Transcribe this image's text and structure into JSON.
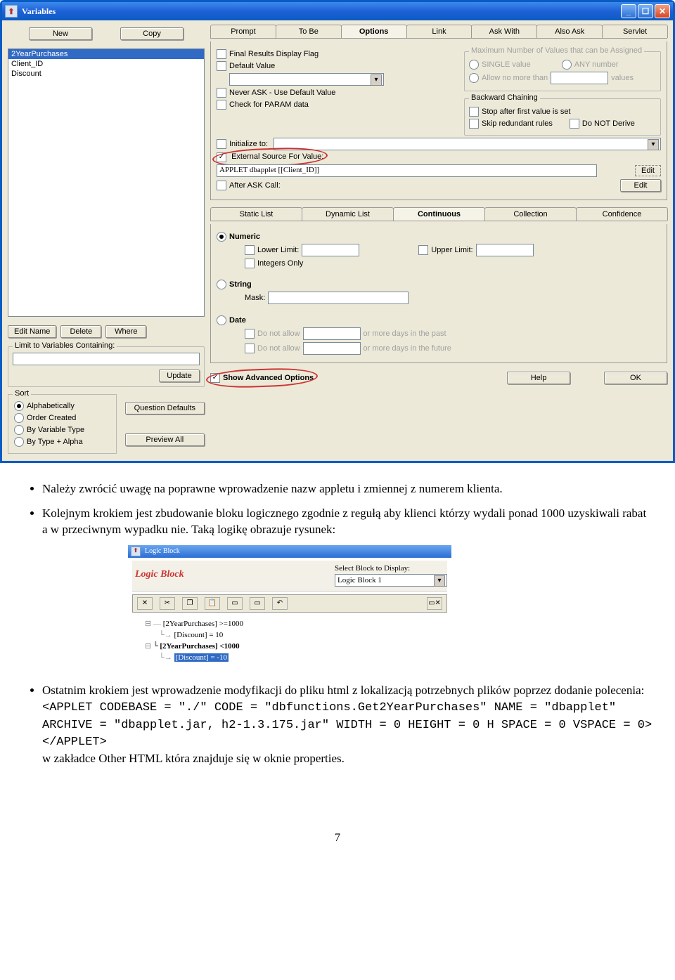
{
  "window": {
    "title": "Variables",
    "buttons": {
      "new": "New",
      "copy": "Copy"
    },
    "list": [
      "2YearPurchases",
      "Client_ID",
      "Discount"
    ],
    "leftButtons": {
      "editName": "Edit Name",
      "delete": "Delete",
      "where": "Where",
      "update": "Update"
    },
    "limitLabel": "Limit to Variables Containing:",
    "sort": {
      "legend": "Sort",
      "alpha": "Alphabetically",
      "order": "Order Created",
      "byVar": "By Variable Type",
      "byType": "By Type + Alpha"
    },
    "sideButtons": {
      "qdef": "Question Defaults",
      "preview": "Preview All"
    },
    "tabs1": [
      "Prompt",
      "To Be",
      "Options",
      "Link",
      "Ask With",
      "Also Ask",
      "Servlet"
    ],
    "options": {
      "finalResults": "Final Results Display Flag",
      "defaultValue": "Default Value",
      "neverAsk": "Never ASK - Use Default Value",
      "checkParam": "Check for PARAM data",
      "initTo": "Initialize to:",
      "extSource": "External Source For Value:",
      "extValue": "APPLET dbapplet [[Client_ID]]",
      "afterAsk": "After ASK Call:",
      "edit": "Edit",
      "maxGroup": "Maximum Number of Values that can be Assigned",
      "single": "SINGLE value",
      "any": "ANY number",
      "allowNoMore": "Allow no more than",
      "valuesWord": "values",
      "backward": "Backward Chaining",
      "stopFirst": "Stop after first value is set",
      "skipRed": "Skip redundant rules",
      "doNotDerive": "Do NOT Derive"
    },
    "tabs2": [
      "Static List",
      "Dynamic List",
      "Continuous",
      "Collection",
      "Confidence"
    ],
    "cont": {
      "numeric": "Numeric",
      "lower": "Lower Limit:",
      "upper": "Upper Limit:",
      "ints": "Integers Only",
      "string": "String",
      "mask": "Mask:",
      "date": "Date",
      "dna1": "Do not allow",
      "past": "or more days in the past",
      "future": "or more days in the future"
    },
    "showAdv": "Show Advanced Options",
    "help": "Help",
    "ok": "OK"
  },
  "doc": {
    "b1": "Należy zwrócić uwagę na poprawne wprowadzenie nazw appletu i zmiennej z numerem klienta.",
    "b2": "Kolejnym krokiem jest zbudowanie bloku logicznego zgodnie z regułą aby klienci którzy wydali ponad 1000 uzyskiwali rabat a w przeciwnym wypadku nie. Taką logikę obrazuje rysunek:",
    "b3a": "Ostatnim krokiem jest wprowadzenie modyfikacji do pliku html z lokalizacją potrzebnych plików poprzez dodanie polecenia:",
    "code": "<APPLET CODEBASE = \"./\" CODE = \"dbfunctions.Get2YearPurchases\" NAME = \"dbapplet\" ARCHIVE = \"dbapplet.jar, h2-1.3.175.jar\" WIDTH = 0 HEIGHT = 0 H SPACE = 0 VSPACE = 0></APPLET>",
    "b3b": "w zakładce Other HTML która znajduje się w oknie properties."
  },
  "logic": {
    "title": "Logic Block",
    "header": "Logic Block",
    "selLabel": "Select Block to Display:",
    "selValue": "Logic Block 1",
    "tree": {
      "c1": "[2YearPurchases] >=1000",
      "r1": "[Discount] = 10",
      "c2": "[2YearPurchases] <1000",
      "r2": "[Discount] = -10"
    }
  },
  "pagenum": "7"
}
